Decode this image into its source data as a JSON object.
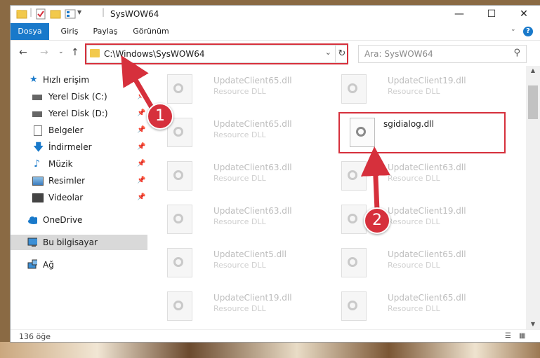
{
  "window": {
    "title": "SysWOW64"
  },
  "ribbon": {
    "tabs": [
      "Dosya",
      "Giriş",
      "Paylaş",
      "Görünüm"
    ]
  },
  "address": {
    "path": "C:\\Windows\\SysWOW64"
  },
  "search": {
    "placeholder": "Ara: SysWOW64"
  },
  "sidebar": {
    "items": [
      {
        "label": "Hızlı erişim"
      },
      {
        "label": "Yerel Disk (C:)"
      },
      {
        "label": "Yerel Disk (D:)"
      },
      {
        "label": "Belgeler"
      },
      {
        "label": "İndirmeler"
      },
      {
        "label": "Müzik"
      },
      {
        "label": "Resimler"
      },
      {
        "label": "Videolar"
      },
      {
        "label": "OneDrive"
      },
      {
        "label": "Bu bilgisayar"
      },
      {
        "label": "Ağ"
      }
    ]
  },
  "files": [
    {
      "name": "UpdateClient65.dll",
      "type": "Resource DLL"
    },
    {
      "name": "UpdateClient19.dll",
      "type": "Resource DLL"
    },
    {
      "name": "UpdateClient65.dll",
      "type": "Resource DLL"
    },
    {
      "name": "sgidialog.dll",
      "type": ""
    },
    {
      "name": "UpdateClient63.dll",
      "type": "Resource DLL"
    },
    {
      "name": "UpdateClient63.dll",
      "type": "Resource DLL"
    },
    {
      "name": "UpdateClient63.dll",
      "type": "Resource DLL"
    },
    {
      "name": "UpdateClient19.dll",
      "type": "Resource DLL"
    },
    {
      "name": "UpdateClient5.dll",
      "type": "Resource DLL"
    },
    {
      "name": "UpdateClient65.dll",
      "type": "Resource DLL"
    },
    {
      "name": "UpdateClient19.dll",
      "type": "Resource DLL"
    },
    {
      "name": "UpdateClient65.dll",
      "type": "Resource DLL"
    }
  ],
  "status": {
    "count": "136 öğe"
  },
  "annotations": {
    "step1": "1",
    "step2": "2"
  },
  "colors": {
    "accent": "#1979ca",
    "highlight": "#d6303c",
    "folder": "#f2c94c"
  }
}
